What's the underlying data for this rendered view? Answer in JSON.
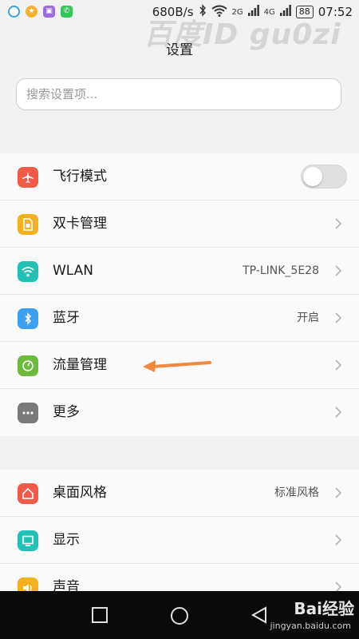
{
  "status_bar": {
    "net_speed": "680B/s",
    "sim1_tag": "2G",
    "sim2_tag": "4G",
    "battery": "88",
    "time": "07:52"
  },
  "watermark": "百度ID gu0zi",
  "header": {
    "title": "设置"
  },
  "search": {
    "placeholder": "搜索设置项..."
  },
  "group1": {
    "items": [
      {
        "label": "飞行模式",
        "icon": "airplane-icon",
        "color": "#f15a47",
        "control": "toggle",
        "toggle_on": false
      },
      {
        "label": "双卡管理",
        "icon": "sim-card-icon",
        "color": "#f5b11d",
        "control": "chevron"
      },
      {
        "label": "WLAN",
        "value": "TP-LINK_5E28",
        "icon": "wifi-icon",
        "color": "#22c0b5",
        "control": "chevron"
      },
      {
        "label": "蓝牙",
        "value": "开启",
        "icon": "bluetooth-icon",
        "color": "#3b9ff3",
        "control": "chevron"
      },
      {
        "label": "流量管理",
        "icon": "data-usage-icon",
        "color": "#6cbb3c",
        "control": "chevron"
      },
      {
        "label": "更多",
        "icon": "more-icon",
        "color": "#7a7a7a",
        "control": "chevron"
      }
    ]
  },
  "group2": {
    "items": [
      {
        "label": "桌面风格",
        "value": "标准风格",
        "icon": "home-icon",
        "color": "#f15a47",
        "control": "chevron"
      },
      {
        "label": "显示",
        "icon": "display-icon",
        "color": "#22c0b5",
        "control": "chevron"
      },
      {
        "label": "声音",
        "icon": "sound-icon",
        "color": "#f5b11d",
        "control": "chevron"
      }
    ]
  },
  "annotation": {
    "arrow_color": "#f0883e"
  },
  "navbar": {
    "brand": "Bai经验",
    "url": "jingyan.baidu.com"
  }
}
